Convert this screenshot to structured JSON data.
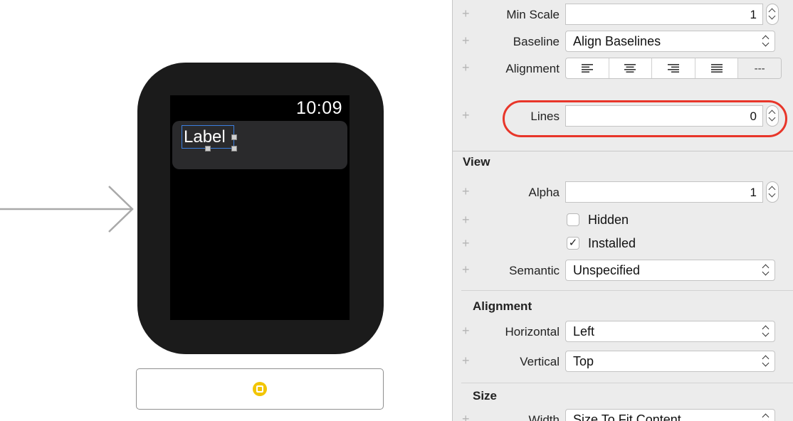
{
  "canvas": {
    "watch_time": "10:09",
    "label_text": "Label"
  },
  "inspector": {
    "plus_symbol": "+",
    "min_scale": {
      "label": "Min Scale",
      "value": "1"
    },
    "baseline": {
      "label": "Baseline",
      "value": "Align Baselines"
    },
    "alignment_row": {
      "label": "Alignment",
      "justified_natural": "---"
    },
    "lines": {
      "label": "Lines",
      "value": "0"
    },
    "view": {
      "title": "View",
      "alpha": {
        "label": "Alpha",
        "value": "1"
      },
      "hidden": {
        "label": "Hidden",
        "checked": false,
        "mark": ""
      },
      "installed": {
        "label": "Installed",
        "checked": true,
        "mark": "✓"
      },
      "semantic": {
        "label": "Semantic",
        "value": "Unspecified"
      }
    },
    "alignment": {
      "title": "Alignment",
      "horizontal": {
        "label": "Horizontal",
        "value": "Left"
      },
      "vertical": {
        "label": "Vertical",
        "value": "Top"
      }
    },
    "size": {
      "title": "Size",
      "width": {
        "label": "Width",
        "value": "Size To Fit Content"
      }
    }
  },
  "colors": {
    "highlight": "#e8362a",
    "selection": "#3b7fe0",
    "controller_icon": "#f2c500"
  }
}
